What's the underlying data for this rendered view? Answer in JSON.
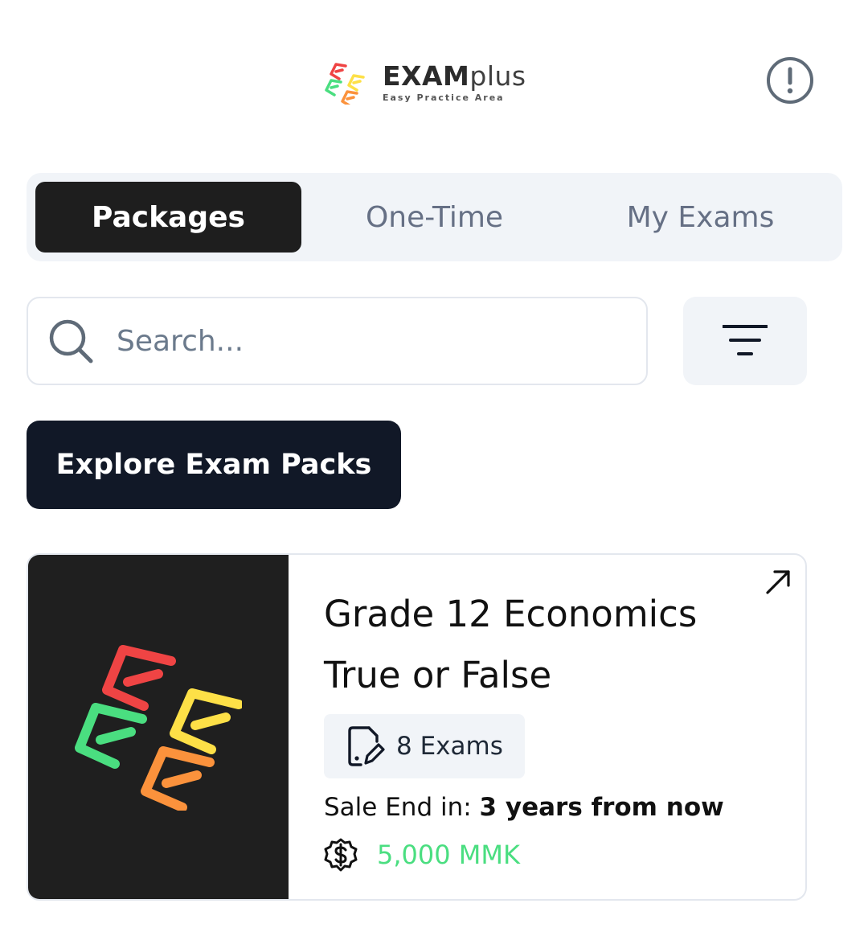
{
  "header": {
    "brand_bold": "EXAM",
    "brand_light": "plus",
    "tagline": "Easy Practice Area",
    "info_icon": "info-circle-icon"
  },
  "tabs": [
    {
      "label": "Packages",
      "active": true
    },
    {
      "label": "One-Time",
      "active": false
    },
    {
      "label": "My Exams",
      "active": false
    }
  ],
  "search": {
    "placeholder": "Search...",
    "value": "",
    "icon": "search-icon"
  },
  "filter": {
    "icon": "filter-icon"
  },
  "explore_button": {
    "label": "Explore Exam Packs"
  },
  "packages": [
    {
      "title": "Grade 12 Economics True or False",
      "exam_count_label": "8 Exams",
      "sale_prefix": "Sale End in: ",
      "sale_value": "3 years from now",
      "price": "5,000 MMK",
      "price_color": "#4ade80"
    }
  ],
  "colors": {
    "tab_active_bg": "#1e1e1e",
    "explore_bg": "#111827",
    "logo_red": "#ef4444",
    "logo_yellow": "#fde047",
    "logo_green": "#4ade80",
    "logo_orange": "#fb923c"
  }
}
